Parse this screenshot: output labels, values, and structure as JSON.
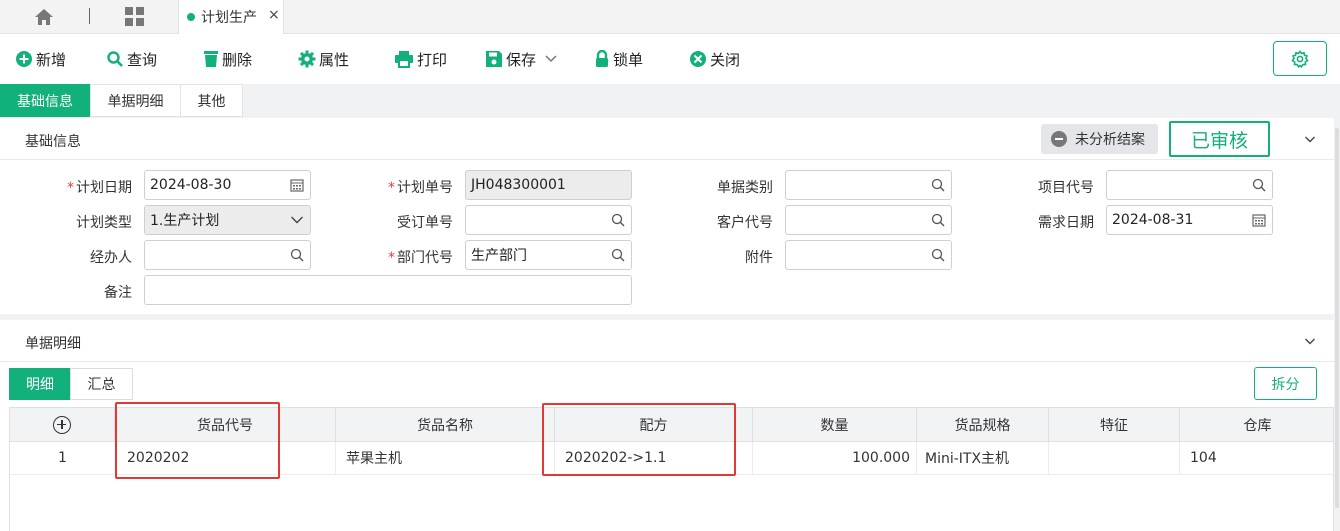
{
  "tabbar": {
    "doc_tab_label": "计划生产",
    "close_symbol": "×"
  },
  "toolbar": {
    "add": "新增",
    "query": "查询",
    "delete": "删除",
    "props": "属性",
    "print": "打印",
    "save": "保存",
    "lock": "锁单",
    "close": "关闭"
  },
  "section_tabs": [
    "基础信息",
    "单据明细",
    "其他"
  ],
  "base": {
    "title": "基础信息",
    "status_label": "未分析结案",
    "approved_label": "已审核",
    "fields": {
      "plan_date_label": "计划日期",
      "plan_date": "2024-08-30",
      "plan_no_label": "计划单号",
      "plan_no": "JH048300001",
      "bill_type_label": "单据类别",
      "bill_type": "",
      "project_label": "项目代号",
      "project": "",
      "plan_type_label": "计划类型",
      "plan_type": "1.生产计划",
      "order_no_label": "受订单号",
      "order_no": "",
      "customer_label": "客户代号",
      "customer": "",
      "need_date_label": "需求日期",
      "need_date": "2024-08-31",
      "handler_label": "经办人",
      "handler": "",
      "dept_label": "部门代号",
      "dept": "生产部门",
      "attach_label": "附件",
      "attach": "",
      "remark_label": "备注",
      "remark": ""
    }
  },
  "detail": {
    "title": "单据明细",
    "subtabs": [
      "明细",
      "汇总"
    ],
    "split_label": "拆分",
    "columns": [
      "货品代号",
      "货品名称",
      "配方",
      "数量",
      "货品规格",
      "特征",
      "仓库"
    ],
    "rows": [
      {
        "no": "1",
        "code": "2020202",
        "name": "苹果主机",
        "formula": "2020202->1.1",
        "qty": "100.000",
        "spec": "Mini-ITX主机",
        "feature": "",
        "warehouse": "104"
      }
    ]
  },
  "colors": {
    "accent": "#12b07a",
    "highlight": "#e03a33"
  }
}
